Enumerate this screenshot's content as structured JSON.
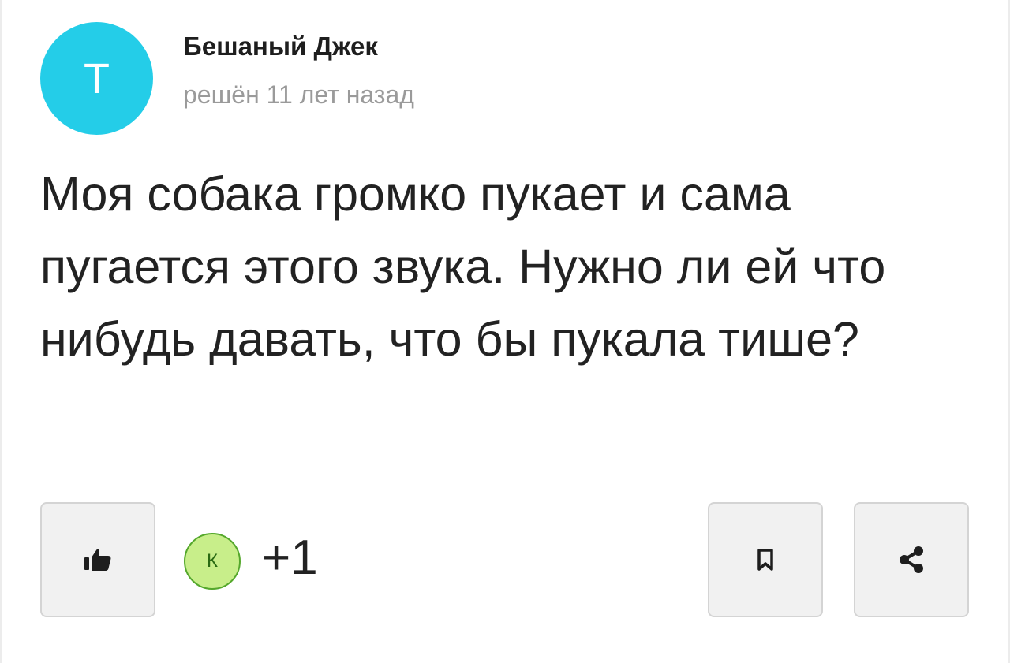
{
  "author": {
    "avatar_letter": "Т",
    "avatar_color": "#24cde8",
    "name": "Бешаный Джек",
    "status": "решён 11 лет назад"
  },
  "question": {
    "text": "Моя собака громко пукает и сама пугается этого звука. Нужно ли ей что нибудь давать, что бы пукала тише?"
  },
  "actions": {
    "like_icon": "thumbs-up-icon",
    "liker_badge_letter": "К",
    "liker_badge_color": "#c8ee8a",
    "like_count": "+1",
    "bookmark_icon": "bookmark-icon",
    "share_icon": "share-icon"
  }
}
